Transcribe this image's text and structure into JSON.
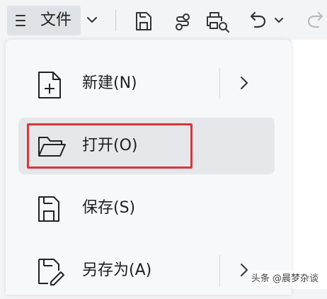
{
  "toolbar": {
    "file_label": "文件"
  },
  "menu": {
    "items": [
      {
        "label": "新建(N)",
        "icon": "new-file-icon",
        "has_submenu": true
      },
      {
        "label": "打开(O)",
        "icon": "folder-open-icon",
        "has_submenu": false,
        "highlighted": true
      },
      {
        "label": "保存(S)",
        "icon": "save-icon",
        "has_submenu": false
      },
      {
        "label": "另存为(A)",
        "icon": "save-as-icon",
        "has_submenu": true
      }
    ]
  },
  "watermark": "头条 @晨梦杂谈",
  "colors": {
    "highlight_border": "#d9363a",
    "hover_bg": "#e6e7ea",
    "file_button_bg": "#dfe2e6"
  }
}
